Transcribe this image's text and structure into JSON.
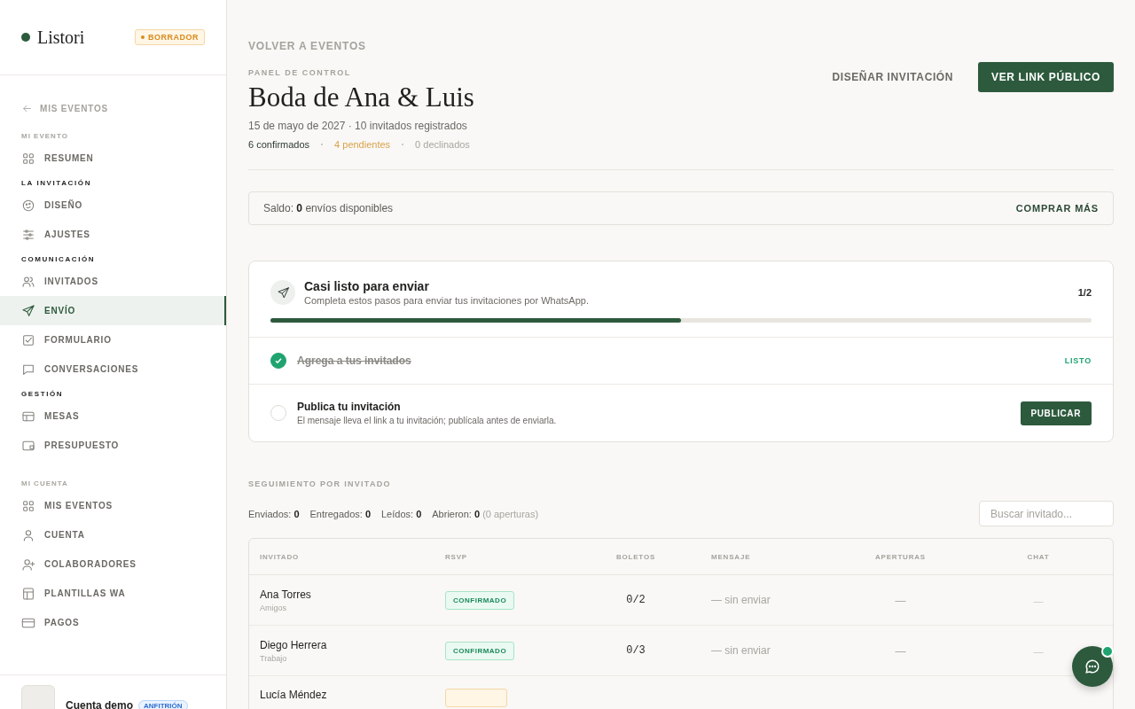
{
  "sidebar": {
    "brand": "Listori",
    "status_badge": "BORRADOR",
    "back_link": "MIS EVENTOS",
    "sections": [
      {
        "title": "MI EVENTO",
        "muted": true,
        "items": [
          {
            "label": "RESUMEN",
            "selected": false
          }
        ]
      },
      {
        "title": "LA INVITACIÓN",
        "muted": false,
        "items": [
          {
            "label": "DISEÑO",
            "selected": false
          },
          {
            "label": "AJUSTES",
            "selected": false
          }
        ]
      },
      {
        "title": "COMUNICACIÓN",
        "muted": false,
        "items": [
          {
            "label": "INVITADOS",
            "selected": false
          },
          {
            "label": "ENVÍO",
            "selected": true
          },
          {
            "label": "FORMULARIO",
            "selected": false
          },
          {
            "label": "CONVERSACIONES",
            "selected": false
          }
        ]
      },
      {
        "title": "GESTIÓN",
        "muted": false,
        "items": [
          {
            "label": "MESAS",
            "selected": false
          },
          {
            "label": "PRESUPUESTO",
            "selected": false
          }
        ]
      },
      {
        "title": "MI CUENTA",
        "muted": true,
        "items": [
          {
            "label": "MIS EVENTOS",
            "selected": false
          },
          {
            "label": "CUENTA",
            "selected": false
          },
          {
            "label": "COLABORADORES",
            "selected": false
          },
          {
            "label": "PLANTILLAS WA",
            "selected": false
          },
          {
            "label": "PAGOS",
            "selected": false
          }
        ]
      }
    ],
    "account": {
      "name": "Cuenta demo",
      "role": "ANFITRIÓN"
    }
  },
  "header": {
    "back_link": "VOLVER A EVENTOS",
    "eyebrow": "PANEL DE CONTROL",
    "title": "Boda de Ana & Luis",
    "meta": "15 de mayo de 2027 · 10 invitados registrados",
    "stats": [
      {
        "label": "6 confirmados",
        "color": "#2d3a30"
      },
      {
        "label": "4 pendientes",
        "color": "#d9a24a"
      },
      {
        "label": "0 declinados",
        "color": "#a8a6a0"
      }
    ],
    "actions": [
      {
        "label": "DISEÑAR INVITACIÓN",
        "kind": "secondary"
      },
      {
        "label": "VER LINK PÚBLICO",
        "kind": "primary"
      }
    ]
  },
  "balance": {
    "text": "Saldo: **0** envíos disponibles",
    "action": "COMPRAR MÁS"
  },
  "checklist": {
    "title": "Casi listo para enviar",
    "subtitle": "Completa estos pasos para enviar tus invitaciones por WhatsApp.",
    "count": "1/2",
    "level": 0.5,
    "steps": [
      {
        "label": "Agrega a tus invitados",
        "done": true,
        "status": "LISTO"
      },
      {
        "label": "Publica tu invitación",
        "description": "El mensaje lleva el link a tu invitación; publícala antes de enviarla.",
        "done": false,
        "action": "PUBLICAR"
      }
    ]
  },
  "tracking": {
    "title": "SEGUIMIENTO POR INVITADO",
    "stats": [
      {
        "label": "Enviados:",
        "value": "0"
      },
      {
        "label": "Entregados:",
        "value": "0"
      },
      {
        "label": "Leídos:",
        "value": "0"
      },
      {
        "label": "Abrieron:",
        "value": "0",
        "note": "(0 aperturas)"
      }
    ],
    "search": {
      "placeholder": "Buscar invitado..."
    },
    "table": {
      "columns": [
        "INVITADO",
        "RSVP",
        "BOLETOS",
        "MENSAJE",
        "APERTURAS",
        "CHAT"
      ],
      "rows": [
        {
          "name": "Ana Torres",
          "group": "Amigos",
          "rsvp": {
            "label": "CONFIRMADO",
            "kind": "confirmed"
          },
          "tickets": "0/2",
          "message": "— sin enviar",
          "opens": "—",
          "chat": "—"
        },
        {
          "name": "Diego Herrera",
          "group": "Trabajo",
          "rsvp": {
            "label": "CONFIRMADO",
            "kind": "confirmed"
          },
          "tickets": "0/3",
          "message": "— sin enviar",
          "opens": "—",
          "chat": "—"
        },
        {
          "name": "Lucía Méndez",
          "rsvp": {
            "kind": "pending"
          }
        }
      ]
    }
  },
  "chat_button": {
    "unread": true
  }
}
